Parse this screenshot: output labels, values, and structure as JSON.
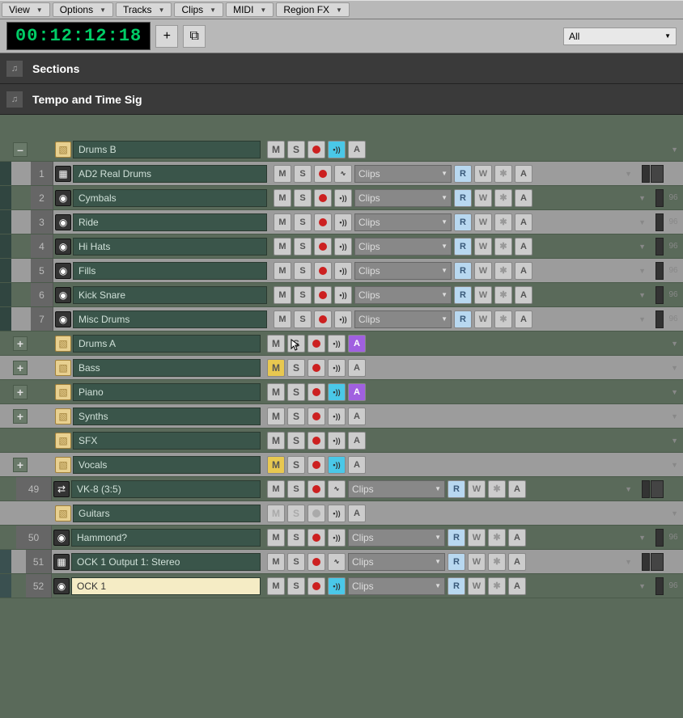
{
  "menubar": {
    "items": [
      "View",
      "Options",
      "Tracks",
      "Clips",
      "MIDI",
      "Region FX"
    ]
  },
  "toolbar": {
    "timecode": "00:12:12:18",
    "add_label": "+",
    "multi_label": "⧉",
    "filter_label": "All"
  },
  "sections": [
    {
      "label": "Sections"
    },
    {
      "label": "Tempo and Time Sig"
    }
  ],
  "btns": {
    "mute": "M",
    "solo": "S",
    "echo": "•))",
    "auto": "A",
    "read": "R",
    "write": "W",
    "star": "✱",
    "auto2": "A",
    "clips": "Clips"
  },
  "tracks": [
    {
      "type": "folder",
      "exp": "–",
      "name": "Drums B",
      "echo_on": true
    },
    {
      "type": "child",
      "num": "1",
      "ico": "wave",
      "name": "AD2 Real Drums",
      "meter": 1
    },
    {
      "type": "child",
      "num": "2",
      "ico": "knob",
      "name": "Cymbals",
      "gain": "96"
    },
    {
      "type": "child",
      "num": "3",
      "ico": "knob",
      "name": "Ride",
      "gain": "96"
    },
    {
      "type": "child",
      "num": "4",
      "ico": "knob",
      "name": "Hi Hats",
      "gain": "96"
    },
    {
      "type": "child",
      "num": "5",
      "ico": "knob",
      "name": "Fills",
      "gain": "96"
    },
    {
      "type": "child",
      "num": "6",
      "ico": "knob",
      "name": "Kick Snare",
      "gain": "96"
    },
    {
      "type": "child",
      "num": "7",
      "ico": "knob",
      "name": "Misc Drums",
      "gain": "96"
    },
    {
      "type": "folder",
      "exp": "+",
      "name": "Drums A",
      "auto_on": true,
      "cursor": true
    },
    {
      "type": "folder",
      "exp": "+",
      "name": "Bass",
      "mute_on": true
    },
    {
      "type": "folder",
      "exp": "+",
      "name": "Piano",
      "echo_on": true,
      "auto_on": true
    },
    {
      "type": "folder",
      "exp": "+",
      "name": "Synths"
    },
    {
      "type": "folder",
      "exp": "",
      "name": "SFX"
    },
    {
      "type": "folder",
      "exp": "+",
      "name": "Vocals",
      "mute_on": true,
      "echo_on": true
    },
    {
      "type": "track",
      "num": "49",
      "ico": "fx",
      "name": "VK-8 (3:5)",
      "meter": 1
    },
    {
      "type": "folder",
      "exp": "",
      "name": "Guitars",
      "disabled": true
    },
    {
      "type": "track",
      "num": "50",
      "ico": "knob",
      "name": "Hammond?",
      "gain": "96"
    },
    {
      "type": "sub",
      "num": "51",
      "ico": "wave",
      "name": "OCK 1 Output 1: Stereo",
      "meter": 1
    },
    {
      "type": "sub",
      "num": "52",
      "ico": "knob",
      "name": "OCK 1",
      "sel": true,
      "echo_on": true,
      "gain": "96"
    }
  ]
}
